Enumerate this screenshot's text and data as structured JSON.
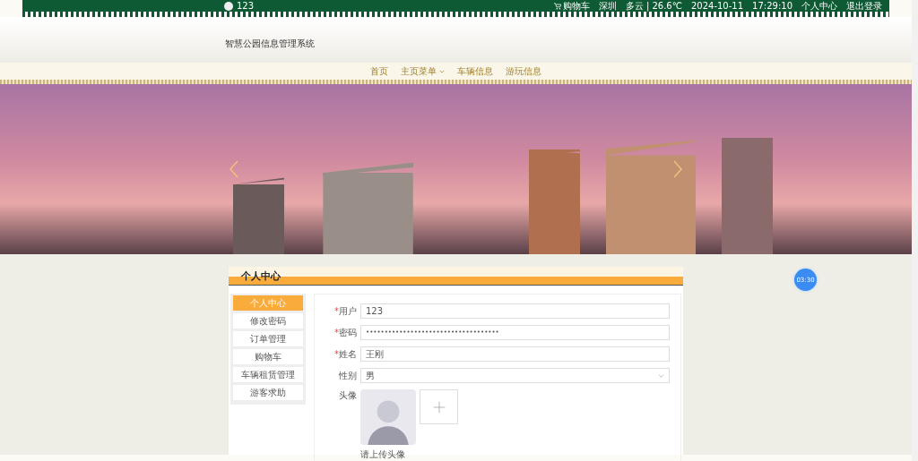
{
  "topbar": {
    "user_name": "123",
    "cart": "购物车",
    "city": "深圳",
    "weather": "多云 | 26.6℃",
    "date": "2024-10-11",
    "time": "17:29:10",
    "links": [
      "个人中心",
      "退出登录"
    ]
  },
  "site_title": "智慧公园信息管理系统",
  "nav": [
    {
      "label": "首页",
      "dropdown": false
    },
    {
      "label": "主页菜单",
      "dropdown": true
    },
    {
      "label": "车辆信息",
      "dropdown": false
    },
    {
      "label": "游玩信息",
      "dropdown": false
    }
  ],
  "panel": {
    "title": "个人中心",
    "side_menu": [
      {
        "label": "个人中心",
        "selected": true
      },
      {
        "label": "修改密码",
        "selected": false
      },
      {
        "label": "订单管理",
        "selected": false
      },
      {
        "label": "购物车",
        "selected": false
      },
      {
        "label": "车辆租赁管理",
        "selected": false
      },
      {
        "label": "游客求助",
        "selected": false
      }
    ],
    "fields": [
      {
        "kind": "text",
        "label": "用户",
        "required": true,
        "value": "123"
      },
      {
        "kind": "password",
        "label": "密码",
        "required": true,
        "value": "••••••••••••••••••••••••••••••••••••"
      },
      {
        "kind": "text",
        "label": "姓名",
        "required": true,
        "value": "王刚"
      },
      {
        "kind": "select",
        "label": "性别",
        "required": false,
        "value": "男"
      }
    ],
    "required_mark": "*",
    "avatar": {
      "label": "头像",
      "hint": "请上传头像"
    }
  },
  "timer": "03:30"
}
